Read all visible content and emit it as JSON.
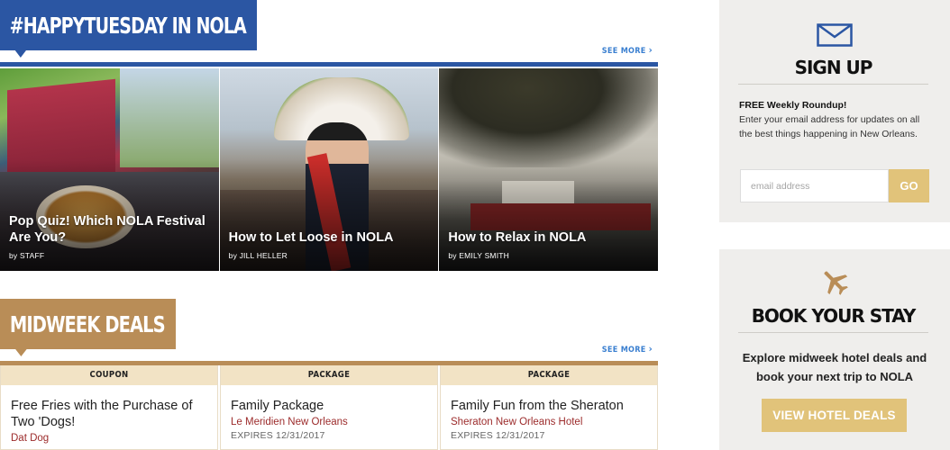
{
  "sections": {
    "happy_tuesday": {
      "title": "#HAPPYTUESDAY IN NOLA",
      "see_more": "SEE MORE"
    },
    "midweek_deals": {
      "title": "MIDWEEK DEALS",
      "see_more": "SEE MORE"
    }
  },
  "articles": [
    {
      "title": "Pop Quiz! Which NOLA Festival Are You?",
      "byline": "by STAFF"
    },
    {
      "title": "How to Let Loose in NOLA",
      "byline": "by JILL HELLER"
    },
    {
      "title": "How to Relax in NOLA",
      "byline": "by EMILY SMITH"
    }
  ],
  "deals": [
    {
      "type": "COUPON",
      "title": "Free Fries with the Purchase of Two 'Dogs!",
      "vendor": "Dat Dog",
      "expires": ""
    },
    {
      "type": "PACKAGE",
      "title": "Family Package",
      "vendor": "Le Meridien New Orleans",
      "expires": "EXPIRES 12/31/2017"
    },
    {
      "type": "PACKAGE",
      "title": "Family Fun from the Sheraton",
      "vendor": "Sheraton New Orleans Hotel",
      "expires": "EXPIRES 12/31/2017"
    }
  ],
  "signup": {
    "icon": "envelope-icon",
    "heading": "SIGN UP",
    "lead": "FREE Weekly Roundup!",
    "description": "Enter your email address for updates on all the best things happening in New Orleans.",
    "email_placeholder": "email address",
    "button": "GO"
  },
  "book_stay": {
    "icon": "airplane-icon",
    "heading": "BOOK YOUR STAY",
    "description": "Explore midweek hotel deals and book your next trip to NOLA",
    "button": "VIEW HOTEL DEALS"
  },
  "colors": {
    "blue_accent": "#2b56a3",
    "gold_accent": "#b98d57",
    "button_gold": "#e1c37a",
    "coupon_header": "#f2e3c5",
    "vendor_red": "#9c2b2b",
    "link_blue": "#3a7fd0"
  }
}
